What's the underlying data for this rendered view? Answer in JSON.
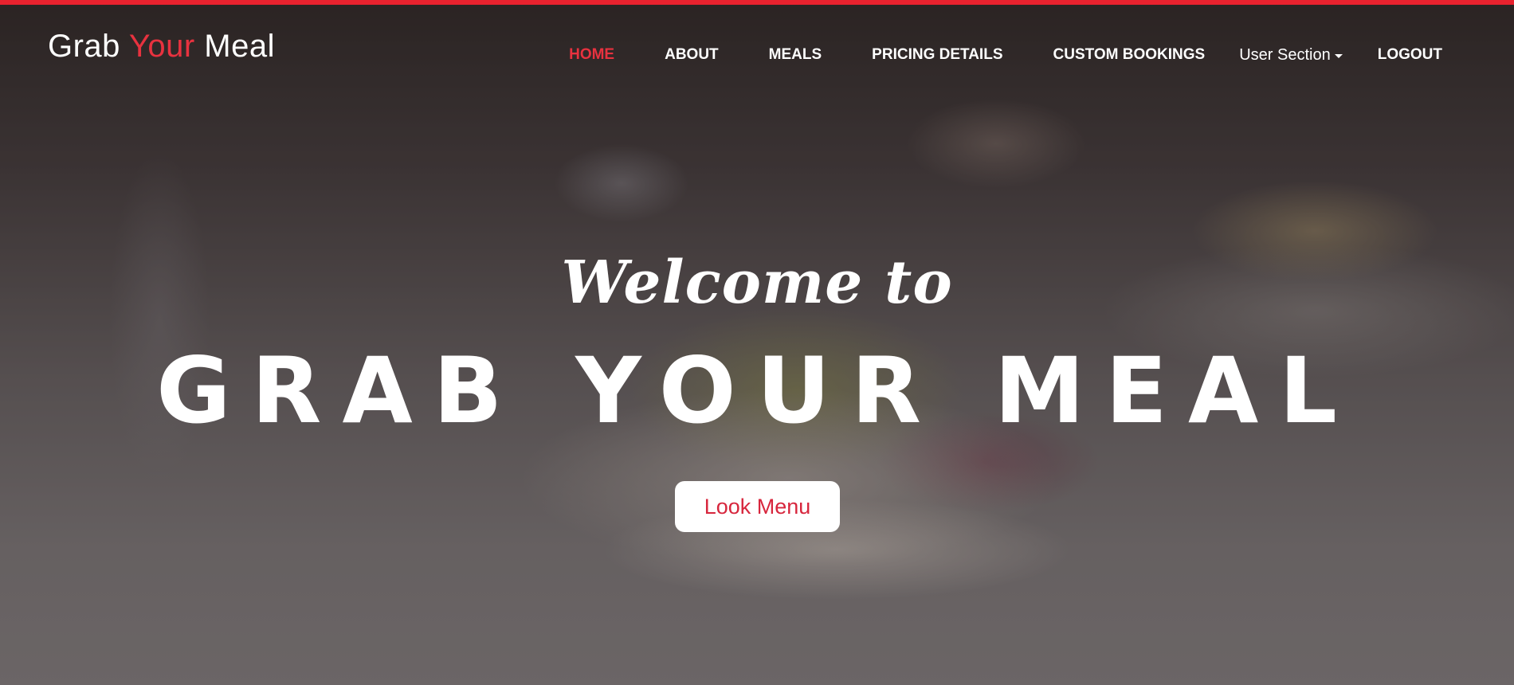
{
  "brand": {
    "part1": "Grab ",
    "part2": "Your",
    "part3": " Meal"
  },
  "nav": {
    "items": [
      {
        "label": "HOME",
        "active": true
      },
      {
        "label": "ABOUT",
        "active": false
      },
      {
        "label": "MEALS",
        "active": false
      },
      {
        "label": "PRICING DETAILS",
        "active": false
      },
      {
        "label": "CUSTOM BOOKINGS",
        "active": false
      }
    ],
    "user_section": "User Section",
    "logout": "LOGOUT"
  },
  "hero": {
    "welcome": "Welcome to",
    "headline": "GRAB YOUR MEAL",
    "cta": "Look Menu"
  },
  "colors": {
    "accent": "#e8222e",
    "active_nav": "#e8323f",
    "cta_text": "#d7263d"
  }
}
